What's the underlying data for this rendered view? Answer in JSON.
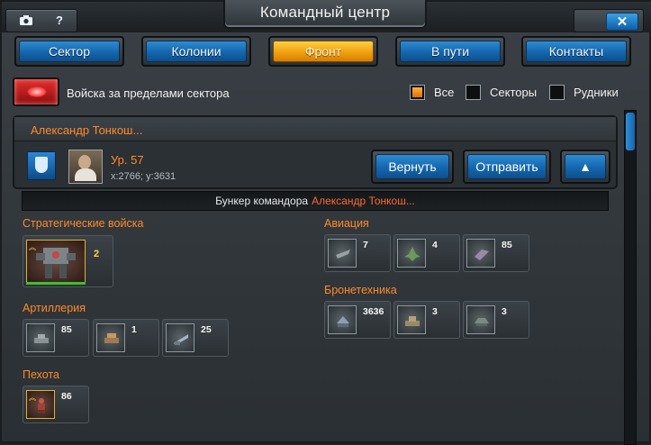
{
  "window": {
    "title": "Командный центр",
    "corner_left": {
      "camera_icon": "camera-icon",
      "help_label": "?"
    },
    "close_label": "✕"
  },
  "nav_tabs": [
    {
      "label": "Сектор",
      "active": false
    },
    {
      "label": "Колонии",
      "active": false
    },
    {
      "label": "Фронт",
      "active": true
    },
    {
      "label": "В пути",
      "active": false
    },
    {
      "label": "Контакты",
      "active": false
    }
  ],
  "filters": {
    "title": "Войска за пределами сектора",
    "options": [
      {
        "label": "Все",
        "checked": true
      },
      {
        "label": "Секторы",
        "checked": false
      },
      {
        "label": "Рудники",
        "checked": false
      }
    ]
  },
  "player": {
    "name": "Александр Тонкош...",
    "level": "Ур. 57",
    "coords": "x:2766; y:3631",
    "buttons": {
      "return": "Вернуть",
      "send": "Отправить",
      "collapse": "▲"
    }
  },
  "bunker": {
    "label": "Бункер командора",
    "name": "Александр Тонкош..."
  },
  "categories": {
    "strategic": {
      "title": "Стратегические войска",
      "units": [
        {
          "count": "2",
          "icon": "mech-walker-icon"
        }
      ]
    },
    "artillery": {
      "title": "Артиллерия",
      "units": [
        {
          "count": "85",
          "icon": "artillery-tank-icon"
        },
        {
          "count": "1",
          "icon": "rocket-launcher-icon"
        },
        {
          "count": "25",
          "icon": "cannon-icon"
        }
      ]
    },
    "infantry": {
      "title": "Пехота",
      "units": [
        {
          "count": "86",
          "icon": "infantry-icon"
        }
      ]
    },
    "aviation": {
      "title": "Авиация",
      "units": [
        {
          "count": "7",
          "icon": "gunship-icon"
        },
        {
          "count": "4",
          "icon": "fighter-icon"
        },
        {
          "count": "85",
          "icon": "bomber-icon"
        }
      ]
    },
    "armor": {
      "title": "Бронетехника",
      "units": [
        {
          "count": "3636",
          "icon": "scout-vehicle-icon"
        },
        {
          "count": "3",
          "icon": "heavy-tank-icon"
        },
        {
          "count": "3",
          "icon": "hover-tank-icon"
        }
      ]
    }
  }
}
